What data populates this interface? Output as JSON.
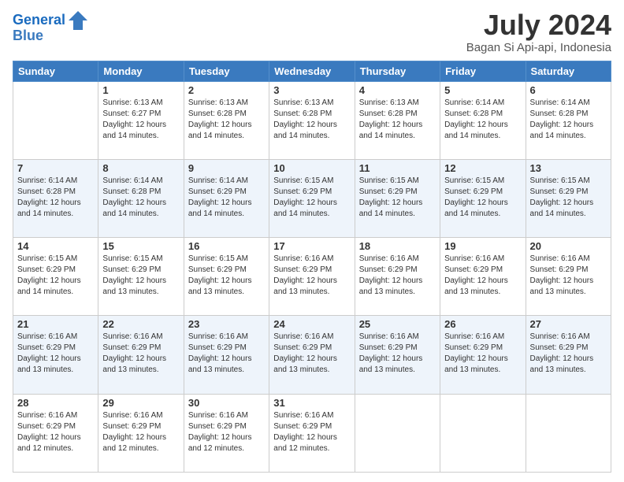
{
  "logo": {
    "line1": "General",
    "line2": "Blue"
  },
  "title": "July 2024",
  "location": "Bagan Si Api-api, Indonesia",
  "days_of_week": [
    "Sunday",
    "Monday",
    "Tuesday",
    "Wednesday",
    "Thursday",
    "Friday",
    "Saturday"
  ],
  "weeks": [
    [
      {
        "num": "",
        "info": ""
      },
      {
        "num": "1",
        "info": "Sunrise: 6:13 AM\nSunset: 6:27 PM\nDaylight: 12 hours\nand 14 minutes."
      },
      {
        "num": "2",
        "info": "Sunrise: 6:13 AM\nSunset: 6:28 PM\nDaylight: 12 hours\nand 14 minutes."
      },
      {
        "num": "3",
        "info": "Sunrise: 6:13 AM\nSunset: 6:28 PM\nDaylight: 12 hours\nand 14 minutes."
      },
      {
        "num": "4",
        "info": "Sunrise: 6:13 AM\nSunset: 6:28 PM\nDaylight: 12 hours\nand 14 minutes."
      },
      {
        "num": "5",
        "info": "Sunrise: 6:14 AM\nSunset: 6:28 PM\nDaylight: 12 hours\nand 14 minutes."
      },
      {
        "num": "6",
        "info": "Sunrise: 6:14 AM\nSunset: 6:28 PM\nDaylight: 12 hours\nand 14 minutes."
      }
    ],
    [
      {
        "num": "7",
        "info": "Sunrise: 6:14 AM\nSunset: 6:28 PM\nDaylight: 12 hours\nand 14 minutes."
      },
      {
        "num": "8",
        "info": "Sunrise: 6:14 AM\nSunset: 6:28 PM\nDaylight: 12 hours\nand 14 minutes."
      },
      {
        "num": "9",
        "info": "Sunrise: 6:14 AM\nSunset: 6:29 PM\nDaylight: 12 hours\nand 14 minutes."
      },
      {
        "num": "10",
        "info": "Sunrise: 6:15 AM\nSunset: 6:29 PM\nDaylight: 12 hours\nand 14 minutes."
      },
      {
        "num": "11",
        "info": "Sunrise: 6:15 AM\nSunset: 6:29 PM\nDaylight: 12 hours\nand 14 minutes."
      },
      {
        "num": "12",
        "info": "Sunrise: 6:15 AM\nSunset: 6:29 PM\nDaylight: 12 hours\nand 14 minutes."
      },
      {
        "num": "13",
        "info": "Sunrise: 6:15 AM\nSunset: 6:29 PM\nDaylight: 12 hours\nand 14 minutes."
      }
    ],
    [
      {
        "num": "14",
        "info": "Sunrise: 6:15 AM\nSunset: 6:29 PM\nDaylight: 12 hours\nand 14 minutes."
      },
      {
        "num": "15",
        "info": "Sunrise: 6:15 AM\nSunset: 6:29 PM\nDaylight: 12 hours\nand 13 minutes."
      },
      {
        "num": "16",
        "info": "Sunrise: 6:15 AM\nSunset: 6:29 PM\nDaylight: 12 hours\nand 13 minutes."
      },
      {
        "num": "17",
        "info": "Sunrise: 6:16 AM\nSunset: 6:29 PM\nDaylight: 12 hours\nand 13 minutes."
      },
      {
        "num": "18",
        "info": "Sunrise: 6:16 AM\nSunset: 6:29 PM\nDaylight: 12 hours\nand 13 minutes."
      },
      {
        "num": "19",
        "info": "Sunrise: 6:16 AM\nSunset: 6:29 PM\nDaylight: 12 hours\nand 13 minutes."
      },
      {
        "num": "20",
        "info": "Sunrise: 6:16 AM\nSunset: 6:29 PM\nDaylight: 12 hours\nand 13 minutes."
      }
    ],
    [
      {
        "num": "21",
        "info": "Sunrise: 6:16 AM\nSunset: 6:29 PM\nDaylight: 12 hours\nand 13 minutes."
      },
      {
        "num": "22",
        "info": "Sunrise: 6:16 AM\nSunset: 6:29 PM\nDaylight: 12 hours\nand 13 minutes."
      },
      {
        "num": "23",
        "info": "Sunrise: 6:16 AM\nSunset: 6:29 PM\nDaylight: 12 hours\nand 13 minutes."
      },
      {
        "num": "24",
        "info": "Sunrise: 6:16 AM\nSunset: 6:29 PM\nDaylight: 12 hours\nand 13 minutes."
      },
      {
        "num": "25",
        "info": "Sunrise: 6:16 AM\nSunset: 6:29 PM\nDaylight: 12 hours\nand 13 minutes."
      },
      {
        "num": "26",
        "info": "Sunrise: 6:16 AM\nSunset: 6:29 PM\nDaylight: 12 hours\nand 13 minutes."
      },
      {
        "num": "27",
        "info": "Sunrise: 6:16 AM\nSunset: 6:29 PM\nDaylight: 12 hours\nand 13 minutes."
      }
    ],
    [
      {
        "num": "28",
        "info": "Sunrise: 6:16 AM\nSunset: 6:29 PM\nDaylight: 12 hours\nand 12 minutes."
      },
      {
        "num": "29",
        "info": "Sunrise: 6:16 AM\nSunset: 6:29 PM\nDaylight: 12 hours\nand 12 minutes."
      },
      {
        "num": "30",
        "info": "Sunrise: 6:16 AM\nSunset: 6:29 PM\nDaylight: 12 hours\nand 12 minutes."
      },
      {
        "num": "31",
        "info": "Sunrise: 6:16 AM\nSunset: 6:29 PM\nDaylight: 12 hours\nand 12 minutes."
      },
      {
        "num": "",
        "info": ""
      },
      {
        "num": "",
        "info": ""
      },
      {
        "num": "",
        "info": ""
      }
    ]
  ]
}
